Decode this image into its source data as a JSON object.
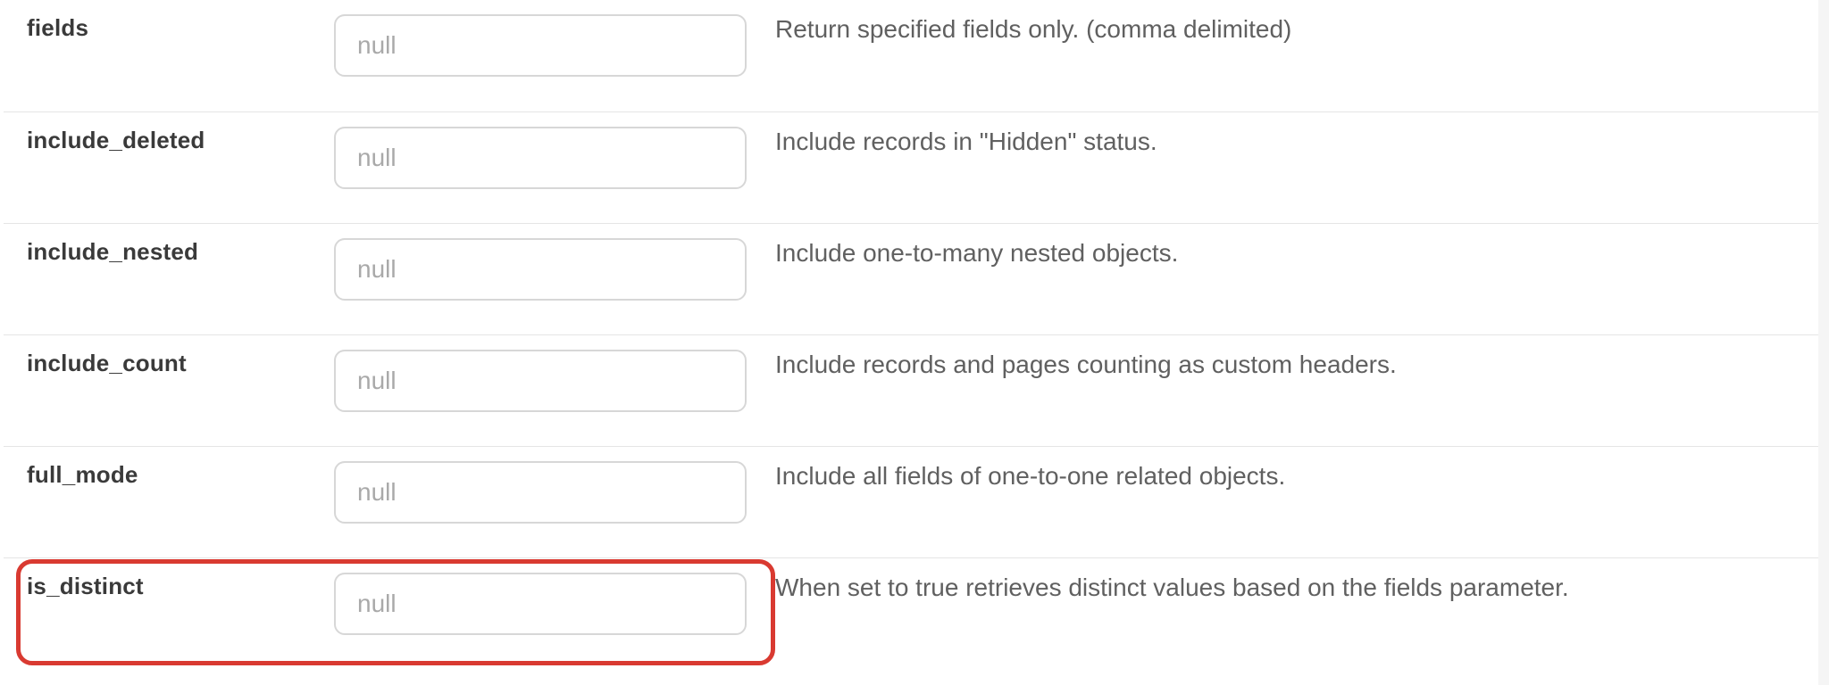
{
  "params": [
    {
      "name": "fields",
      "placeholder": "null",
      "desc": "Return specified fields only. (comma delimited)"
    },
    {
      "name": "include_deleted",
      "placeholder": "null",
      "desc": "Include records in \"Hidden\" status."
    },
    {
      "name": "include_nested",
      "placeholder": "null",
      "desc": "Include one-to-many nested objects."
    },
    {
      "name": "include_count",
      "placeholder": "null",
      "desc": "Include records and pages counting as custom headers."
    },
    {
      "name": "full_mode",
      "placeholder": "null",
      "desc": "Include all fields of one-to-one related objects."
    },
    {
      "name": "is_distinct",
      "placeholder": "null",
      "desc": "When set to true retrieves distinct values based on the fields parameter."
    }
  ],
  "highlight_row_index": 5,
  "colors": {
    "highlight_border": "#d93a31",
    "row_divider": "#e5e5e5",
    "input_border": "#d7d7d7",
    "placeholder": "#a9a9a9",
    "text": "#606060",
    "name_text": "#3a3a3a"
  }
}
